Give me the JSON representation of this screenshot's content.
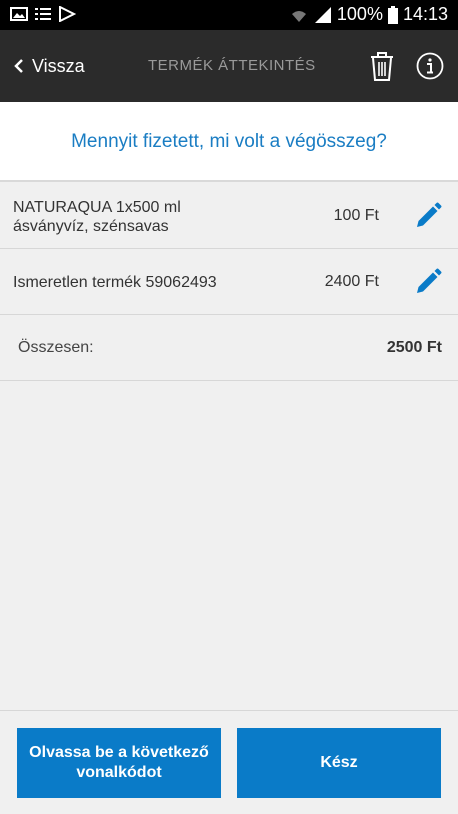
{
  "status_bar": {
    "battery": "100%",
    "time": "14:13"
  },
  "app_bar": {
    "back_label": "Vissza",
    "title": "TERMÉK ÁTTEKINTÉS"
  },
  "question": "Mennyit fizetett, mi volt a végösszeg?",
  "items": [
    {
      "name_line1": "NATURAQUA 1x500 ml",
      "name_line2": "ásványvíz, szénsavas",
      "price": "100 Ft"
    },
    {
      "name_line1": "Ismeretlen termék 59062493",
      "name_line2": "",
      "price": "2400 Ft"
    }
  ],
  "total": {
    "label": "Összesen:",
    "value": "2500 Ft"
  },
  "buttons": {
    "next_line1": "Olvassa be a következő",
    "next_line2": "vonalkódot",
    "done": "Kész"
  },
  "colors": {
    "accent": "#0a7bc8",
    "question_text": "#1a7dc3",
    "app_bar": "#2b2b2b"
  }
}
